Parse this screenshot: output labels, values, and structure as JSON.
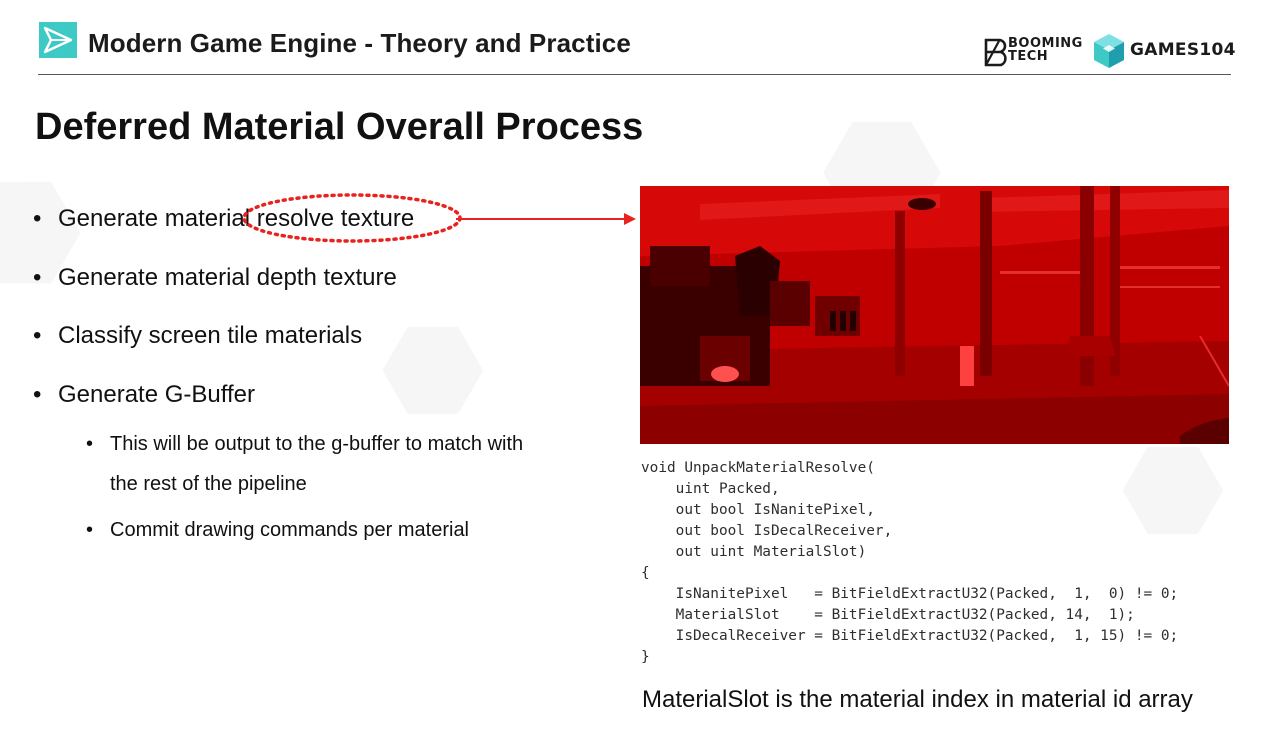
{
  "header": {
    "title": "Modern Game Engine - Theory and Practice",
    "booming_line1": "BOOMING",
    "booming_line2": "TECH",
    "games_brand": "GAMES104",
    "accent_color": "#3ec9c6"
  },
  "slide": {
    "title": "Deferred Material Overall Process",
    "bullets": [
      {
        "text": "Generate material resolve texture"
      },
      {
        "text": "Generate material depth texture"
      },
      {
        "text": "Classify screen tile materials"
      },
      {
        "text": "Generate G-Buffer"
      }
    ],
    "sub_bullets": [
      {
        "line1": "This will be output to the g-buffer to match with",
        "line2": "the rest of the pipeline"
      },
      {
        "line1": "Commit drawing commands per material"
      }
    ],
    "bullet_glyph": "•",
    "annotation_color": "#e8231f"
  },
  "figure": {
    "image_icon": "material-resolve-render-image",
    "tint_color": "#c40000"
  },
  "code": {
    "lines": [
      "void UnpackMaterialResolve(",
      "    uint Packed,",
      "    out bool IsNanitePixel,",
      "    out bool IsDecalReceiver,",
      "    out uint MaterialSlot)",
      "{",
      "    IsNanitePixel   = BitFieldExtractU32(Packed,  1,  0) != 0;",
      "    MaterialSlot    = BitFieldExtractU32(Packed, 14,  1);",
      "    IsDecalReceiver = BitFieldExtractU32(Packed,  1, 15) != 0;",
      "}"
    ]
  },
  "caption": "MaterialSlot is the material index in material id array"
}
